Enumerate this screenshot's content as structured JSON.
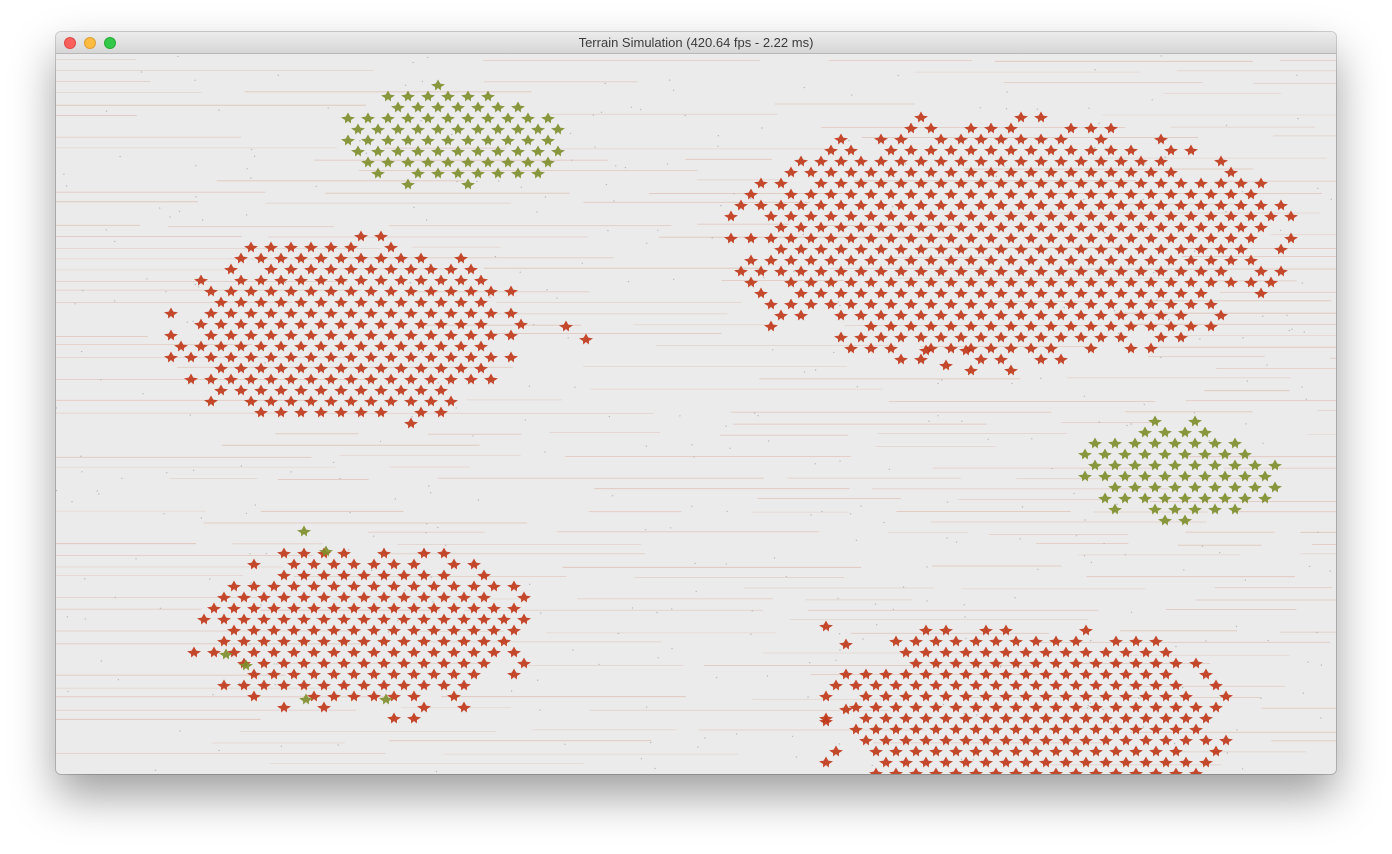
{
  "window": {
    "title": "Terrain Simulation (420.64 fps - 2.22 ms)",
    "buttons": {
      "close": "close-window",
      "minimize": "minimize-window",
      "zoom": "zoom-window"
    }
  },
  "scene": {
    "background_color": "#ebebeb",
    "line_color": "#d9b8aa",
    "unit_colors": {
      "red": "#c0391b",
      "green": "#7f8f2e"
    }
  }
}
